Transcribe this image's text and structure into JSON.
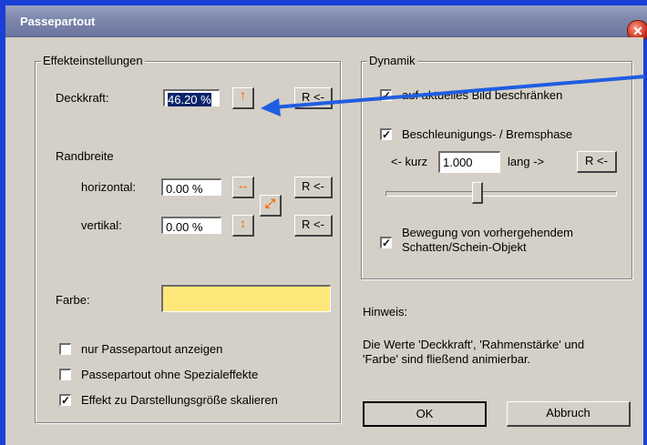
{
  "window": {
    "title": "Passepartout",
    "close_glyph": "✕"
  },
  "effects": {
    "legend": "Effekteinstellungen",
    "opacity": {
      "label": "Deckkraft:",
      "value": "46.20 %",
      "reset": "R <-"
    },
    "border_width": {
      "label": "Randbreite",
      "horizontal": {
        "label": "horizontal:",
        "value": "0.00 %",
        "reset": "R <-"
      },
      "vertical": {
        "label": "vertikal:",
        "value": "0.00 %",
        "reset": "R <-"
      }
    },
    "color": {
      "label": "Farbe:",
      "value": "#ffe87a"
    },
    "options": [
      {
        "label": "nur Passepartout anzeigen",
        "checked": false
      },
      {
        "label": "Passepartout ohne Spezialeffekte",
        "checked": false
      },
      {
        "label": "Effekt zu Darstellungsgröße skalieren",
        "checked": true
      }
    ]
  },
  "dynamics": {
    "legend": "Dynamik",
    "limit_current": {
      "label": "auf aktuelles Bild beschränken",
      "checked": true
    },
    "accel": {
      "label": "Beschleunigungs- / Bremsphase",
      "checked": true
    },
    "short_label": "<- kurz",
    "long_label": "lang ->",
    "accel_value": "1.000",
    "reset": "R <-",
    "slider_position": 0.4,
    "motion": {
      "label": "Bewegung von vorhergehendem\nSchatten/Schein-Objekt",
      "checked": true
    }
  },
  "hint": {
    "title": "Hinweis:",
    "text": "Die Werte 'Deckkraft', 'Rahmenstärke' und\n'Farbe' sind fließend animierbar."
  },
  "buttons": {
    "ok": "OK",
    "cancel": "Abbruch"
  }
}
